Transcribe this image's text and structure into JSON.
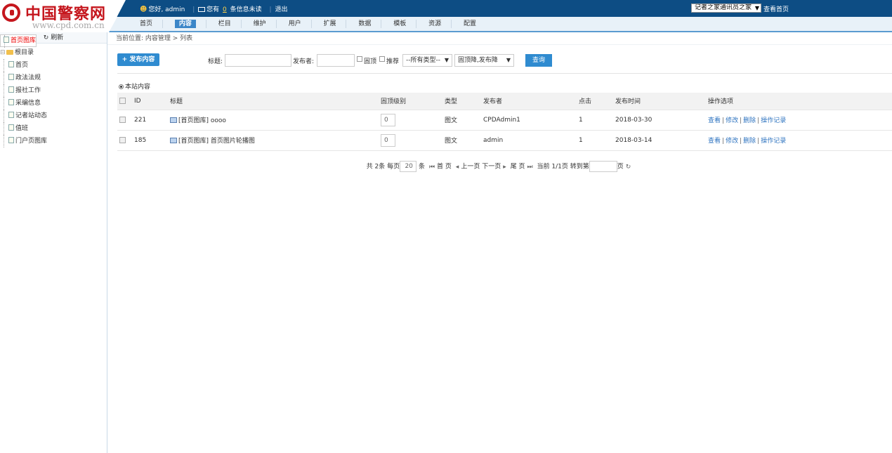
{
  "logo": {
    "brand": "中国警察网",
    "url": "www.cpd.com.cn"
  },
  "topbar": {
    "greeting": "您好, admin",
    "msg_prefix": "您有",
    "msg_count": "0",
    "msg_suffix": "条信息未读",
    "logout": "退出",
    "site_select": "记者之家通讯员之家",
    "view_home": "查看首页"
  },
  "nav": {
    "items": [
      "首页",
      "内容",
      "栏目",
      "维护",
      "用户",
      "扩展",
      "数据",
      "模板",
      "资源",
      "配置"
    ],
    "active": "内容"
  },
  "sidebar": {
    "refresh": "刷新",
    "root": "根目录",
    "items": [
      {
        "label": "首页图库",
        "selected": true
      },
      {
        "label": "首页"
      },
      {
        "label": "政法法规"
      },
      {
        "label": "报社工作"
      },
      {
        "label": "采编信息"
      },
      {
        "label": "记者站动态"
      },
      {
        "label": "值班"
      },
      {
        "label": "门户页图库"
      }
    ]
  },
  "breadcrumb": "当前位置: 内容管理 > 列表",
  "search": {
    "publish_button": "+ 发布内容",
    "title_label": "标题:",
    "title_value": "",
    "publisher_label": "发布者:",
    "publisher_value": "",
    "top_label": "固顶",
    "recommend_label": "推荐",
    "type_select": "--所有类型--",
    "order_select": "固顶降,发布降",
    "query_button": "查询"
  },
  "scope": "本站内容",
  "table": {
    "headers": [
      "ID",
      "标题",
      "固顶级别",
      "类型",
      "发布者",
      "点击",
      "发布时间",
      "操作选项"
    ],
    "rows": [
      {
        "id": "221",
        "title": "[首页图库] oooo",
        "level": "0",
        "type": "图文",
        "publisher": "CPDAdmin1",
        "clicks": "1",
        "date": "2018-03-30"
      },
      {
        "id": "185",
        "title": "[首页图库] 首页图片轮播图",
        "level": "0",
        "type": "图文",
        "publisher": "admin",
        "clicks": "1",
        "date": "2018-03-14"
      }
    ],
    "actions": [
      "查看",
      "修改",
      "删除",
      "操作记录"
    ]
  },
  "pager": {
    "total": "共 2条",
    "per_page_label": "每页",
    "per_page": "20",
    "per_page_unit": "条",
    "first": "首 页",
    "prev": "上一页",
    "next": "下一页",
    "last": "尾 页",
    "current": "当前 1/1页",
    "goto": "转到第",
    "page_unit": "页"
  }
}
